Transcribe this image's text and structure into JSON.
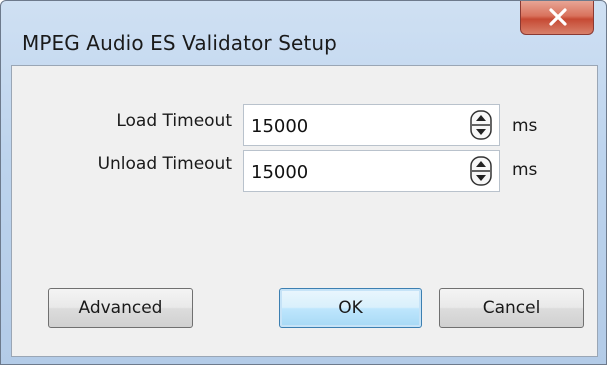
{
  "window": {
    "title": "MPEG Audio ES Validator Setup",
    "close_icon": "close-x-icon"
  },
  "fields": [
    {
      "label": "Load Timeout",
      "value": "15000",
      "unit": "ms"
    },
    {
      "label": "Unload Timeout",
      "value": "15000",
      "unit": "ms"
    }
  ],
  "buttons": {
    "advanced": "Advanced",
    "ok": "OK",
    "cancel": "Cancel"
  },
  "colors": {
    "title_bar": "#bcd3ed",
    "close_button": "#c64a34",
    "client_bg": "#f0f0f0",
    "default_button": "#bee6fd"
  }
}
